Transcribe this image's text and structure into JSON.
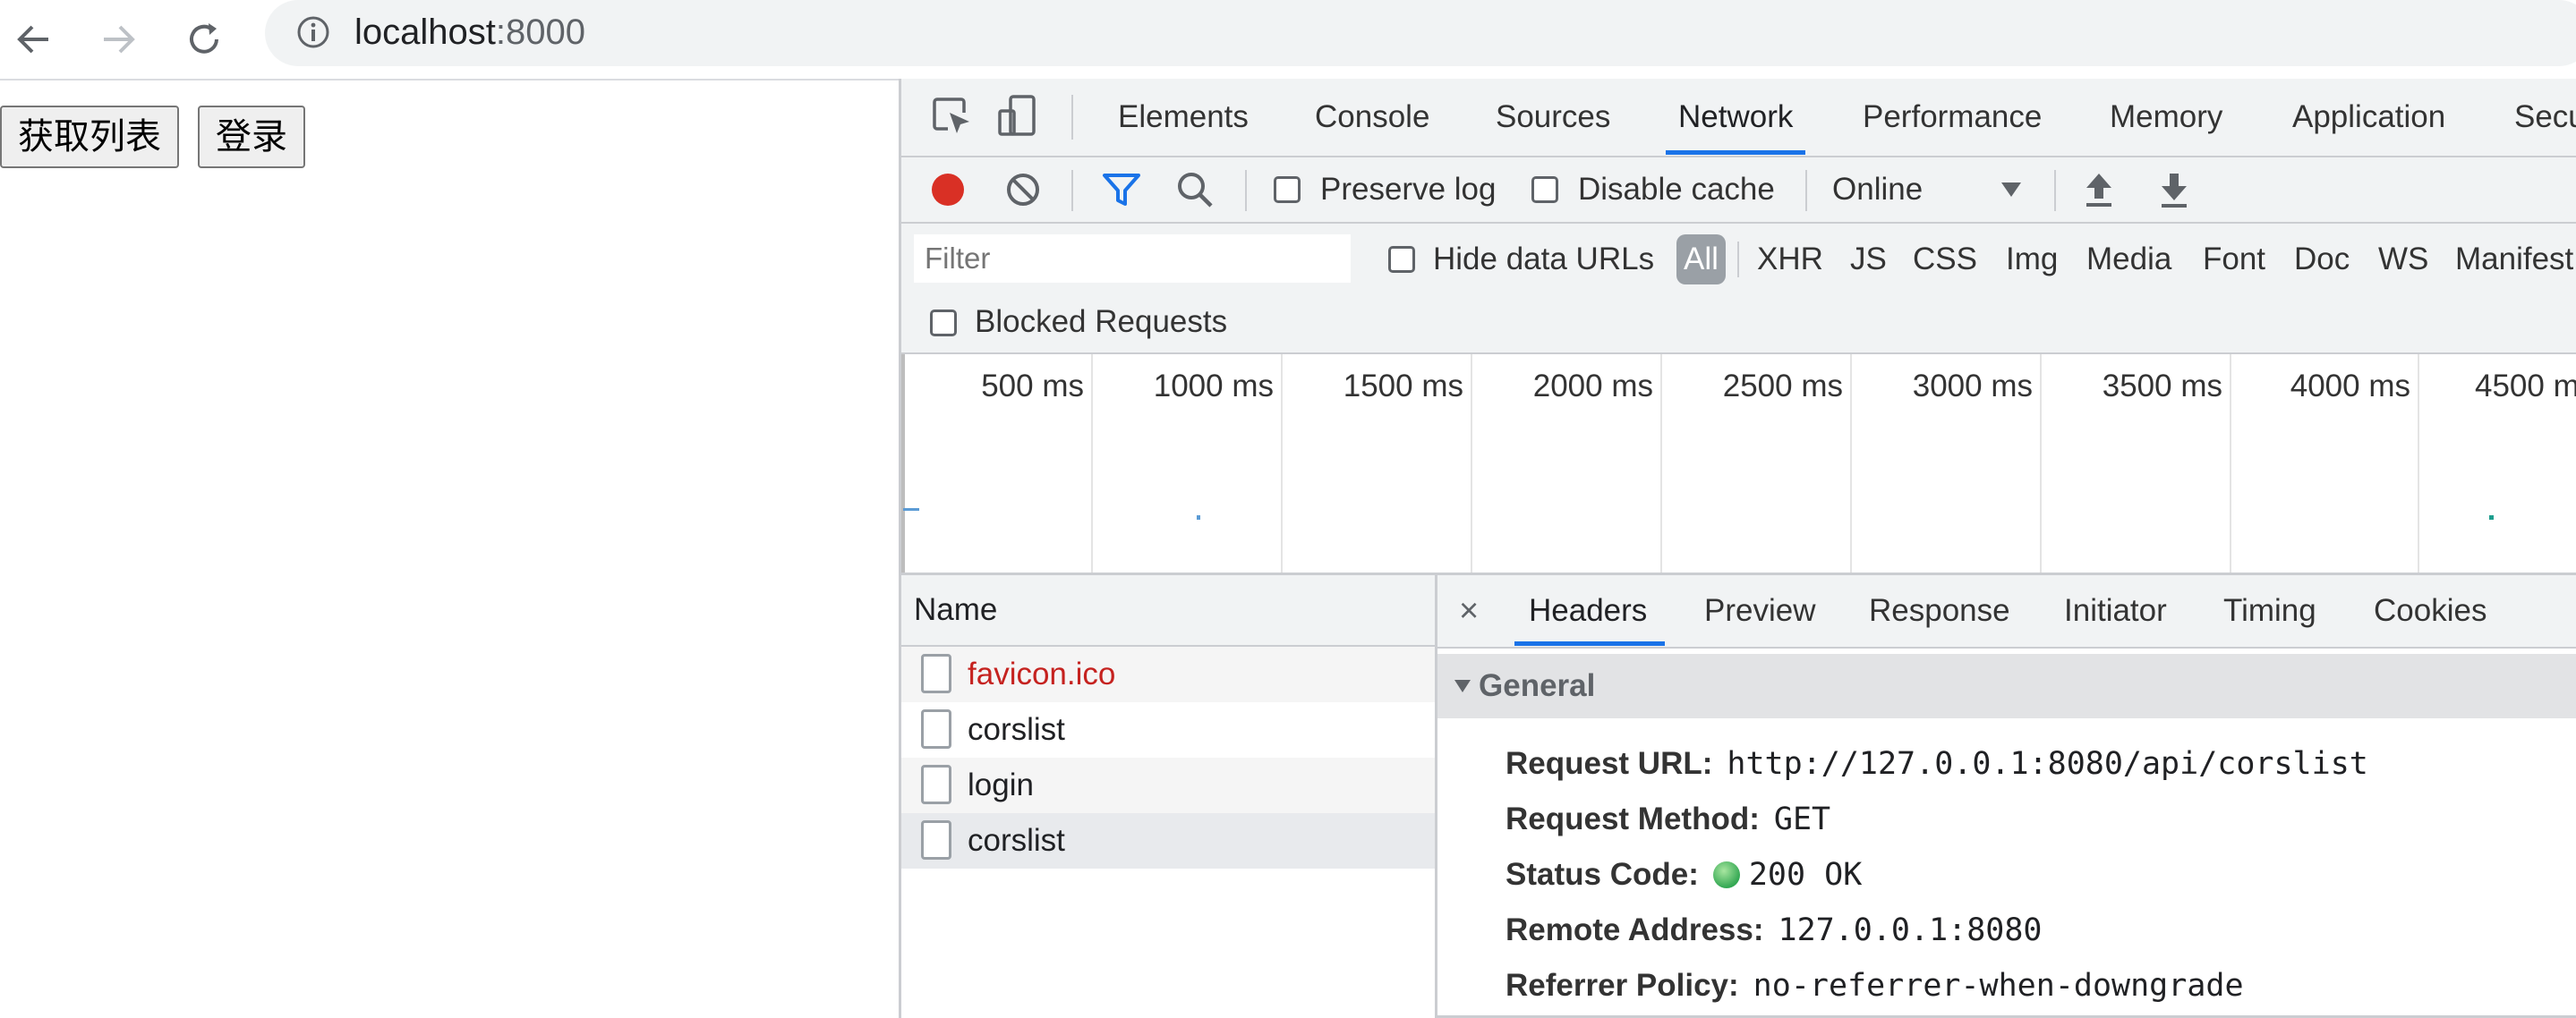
{
  "browser": {
    "url_host": "localhost",
    "url_port": ":8000"
  },
  "page": {
    "buttons": [
      {
        "label": "获取列表"
      },
      {
        "label": "登录"
      }
    ]
  },
  "devtools": {
    "tabs": [
      "Elements",
      "Console",
      "Sources",
      "Network",
      "Performance",
      "Memory",
      "Application",
      "Secu"
    ],
    "active_tab": "Network",
    "controls": {
      "preserve_log": "Preserve log",
      "disable_cache": "Disable cache",
      "throttling": "Online"
    },
    "filter": {
      "placeholder": "Filter",
      "hide_data_urls": "Hide data URLs",
      "types": [
        "All",
        "XHR",
        "JS",
        "CSS",
        "Img",
        "Media",
        "Font",
        "Doc",
        "WS",
        "Manifest"
      ],
      "blocked_requests": "Blocked Requests"
    },
    "timeline": {
      "ticks": [
        "500 ms",
        "1000 ms",
        "1500 ms",
        "2000 ms",
        "2500 ms",
        "3000 ms",
        "3500 ms",
        "4000 ms",
        "4500 m"
      ]
    },
    "requests": {
      "column": "Name",
      "rows": [
        {
          "name": "favicon.ico"
        },
        {
          "name": "corslist"
        },
        {
          "name": "login"
        },
        {
          "name": "corslist"
        }
      ]
    },
    "detail": {
      "close": "×",
      "tabs": [
        "Headers",
        "Preview",
        "Response",
        "Initiator",
        "Timing",
        "Cookies"
      ],
      "section": "General",
      "fields": [
        {
          "key": "Request URL:",
          "value": "http://127.0.0.1:8080/api/corslist"
        },
        {
          "key": "Request Method:",
          "value": "GET"
        },
        {
          "key": "Status Code:",
          "value": "200 OK"
        },
        {
          "key": "Remote Address:",
          "value": "127.0.0.1:8080"
        },
        {
          "key": "Referrer Policy:",
          "value": "no-referrer-when-downgrade"
        }
      ]
    },
    "colors": {
      "accent": "#1a73e8",
      "record": "#d93025",
      "error_text": "#c5221f",
      "status_ok": "#34a853"
    }
  }
}
